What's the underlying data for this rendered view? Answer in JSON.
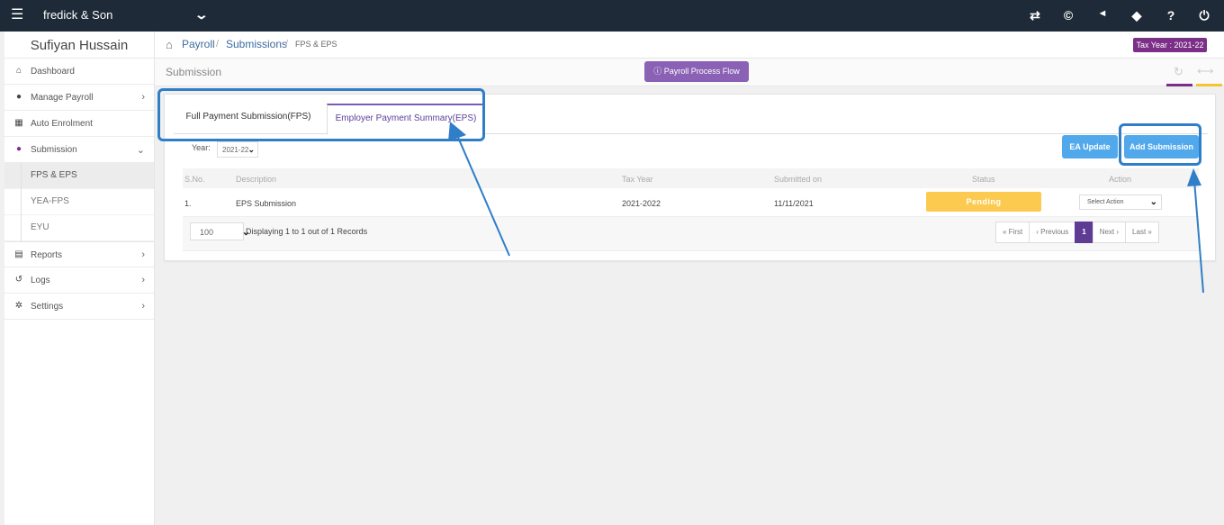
{
  "topbar": {
    "menu_icon": "hamburger-icon",
    "company": "fredick & Son",
    "icons": [
      "swap-icon",
      "currency-icon",
      "megaphone-icon",
      "tag-icon",
      "help-icon",
      "power-icon"
    ],
    "icon_glyphs": [
      "⇄",
      "©",
      "📢",
      "🏷",
      "?",
      "⏻"
    ]
  },
  "sidebar": {
    "user_name": "Sufiyan Hussain",
    "items": [
      {
        "label": "Dashboard",
        "icon": "home-icon"
      },
      {
        "label": "Manage Payroll",
        "icon": "user-icon"
      },
      {
        "label": "Auto Enrolment",
        "icon": "grid-icon"
      },
      {
        "label": "Submission",
        "icon": "users-icon"
      }
    ],
    "submenu": [
      {
        "label": "FPS & EPS"
      },
      {
        "label": "YEA-FPS"
      },
      {
        "label": "EYU"
      }
    ],
    "bottom_items": [
      {
        "label": "Reports",
        "icon": "report-icon"
      },
      {
        "label": "Logs",
        "icon": "history-icon"
      },
      {
        "label": "Settings",
        "icon": "gear-icon"
      }
    ]
  },
  "breadcrumb": {
    "items": [
      "Payroll",
      "Submissions",
      "FPS & EPS"
    ],
    "separator": "/"
  },
  "tax_year_badge": "Tax Year : 2021-22",
  "page": {
    "title": "Submission",
    "flow_button": "Payroll Process Flow"
  },
  "tabs": [
    {
      "label": "Full Payment Submission(FPS)",
      "active": false
    },
    {
      "label": "Employer Payment Summary(EPS)",
      "active": true
    }
  ],
  "filters": {
    "year_label": "Year:",
    "year_value": "2021-22"
  },
  "buttons": {
    "ea_update": "EA Update",
    "add_submission": "Add Submission"
  },
  "table": {
    "columns": [
      "S.No.",
      "Description",
      "Tax Year",
      "Submitted on",
      "Status",
      "Action"
    ],
    "rows": [
      {
        "sno": "1.",
        "description": "EPS Submission",
        "tax_year": "2021-2022",
        "submitted_on": "11/11/2021",
        "status": "Pending",
        "action": "Select Action"
      }
    ]
  },
  "pagination": {
    "page_size": "100",
    "summary": "Displaying 1 to 1 out of 1 Records",
    "first": "« First",
    "previous": "‹ Previous",
    "current": "1",
    "next": "Next ›",
    "last": "Last »"
  },
  "colors": {
    "topbar": "#1e2a38",
    "accent_purple": "#7b2f87",
    "button_blue": "#51a9ec",
    "pending": "#fcca4f",
    "annotation_blue": "#2f7ec7"
  }
}
